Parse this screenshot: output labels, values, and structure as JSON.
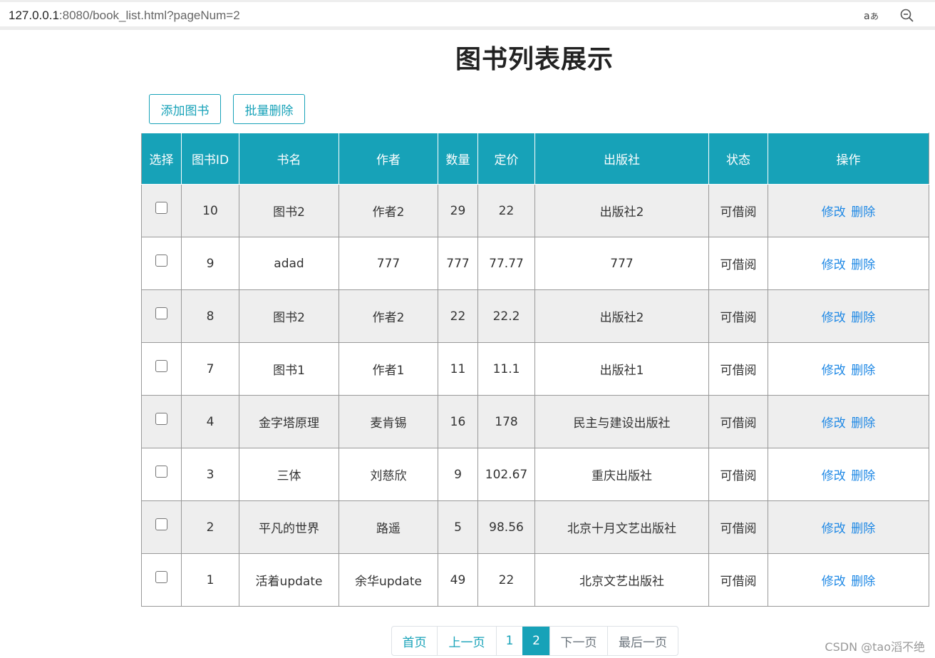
{
  "browser": {
    "url_host": "127.0.0.1",
    "url_rest": ":8080/book_list.html?pageNum=2",
    "read_aloud_icon": "read-aloud-icon",
    "zoom_icon": "zoom-out-icon"
  },
  "page": {
    "title": "图书列表展示",
    "add_button": "添加图书",
    "batch_delete_button": "批量删除"
  },
  "table": {
    "headers": [
      "选择",
      "图书ID",
      "书名",
      "作者",
      "数量",
      "定价",
      "出版社",
      "状态",
      "操作"
    ],
    "rows": [
      {
        "id": "10",
        "name": "图书2",
        "author": "作者2",
        "count": "29",
        "price": "22",
        "publisher": "出版社2",
        "status": "可借阅",
        "edit": "修改",
        "delete": "删除"
      },
      {
        "id": "9",
        "name": "adad",
        "author": "777",
        "count": "777",
        "price": "77.77",
        "publisher": "777",
        "status": "可借阅",
        "edit": "修改",
        "delete": "删除"
      },
      {
        "id": "8",
        "name": "图书2",
        "author": "作者2",
        "count": "22",
        "price": "22.2",
        "publisher": "出版社2",
        "status": "可借阅",
        "edit": "修改",
        "delete": "删除"
      },
      {
        "id": "7",
        "name": "图书1",
        "author": "作者1",
        "count": "11",
        "price": "11.1",
        "publisher": "出版社1",
        "status": "可借阅",
        "edit": "修改",
        "delete": "删除"
      },
      {
        "id": "4",
        "name": "金字塔原理",
        "author": "麦肯锡",
        "count": "16",
        "price": "178",
        "publisher": "民主与建设出版社",
        "status": "可借阅",
        "edit": "修改",
        "delete": "删除"
      },
      {
        "id": "3",
        "name": "三体",
        "author": "刘慈欣",
        "count": "9",
        "price": "102.67",
        "publisher": "重庆出版社",
        "status": "可借阅",
        "edit": "修改",
        "delete": "删除"
      },
      {
        "id": "2",
        "name": "平凡的世界",
        "author": "路遥",
        "count": "5",
        "price": "98.56",
        "publisher": "北京十月文艺出版社",
        "status": "可借阅",
        "edit": "修改",
        "delete": "删除"
      },
      {
        "id": "1",
        "name": "活着update",
        "author": "余华update",
        "count": "49",
        "price": "22",
        "publisher": "北京文艺出版社",
        "status": "可借阅",
        "edit": "修改",
        "delete": "删除"
      }
    ]
  },
  "pagination": {
    "first": "首页",
    "prev": "上一页",
    "page1": "1",
    "page2": "2",
    "next": "下一页",
    "last": "最后一页"
  },
  "watermark": "CSDN @tao滔不绝",
  "colors": {
    "accent": "#17a2b8",
    "link": "#1e88e5",
    "row_alt": "#eeeeee"
  }
}
